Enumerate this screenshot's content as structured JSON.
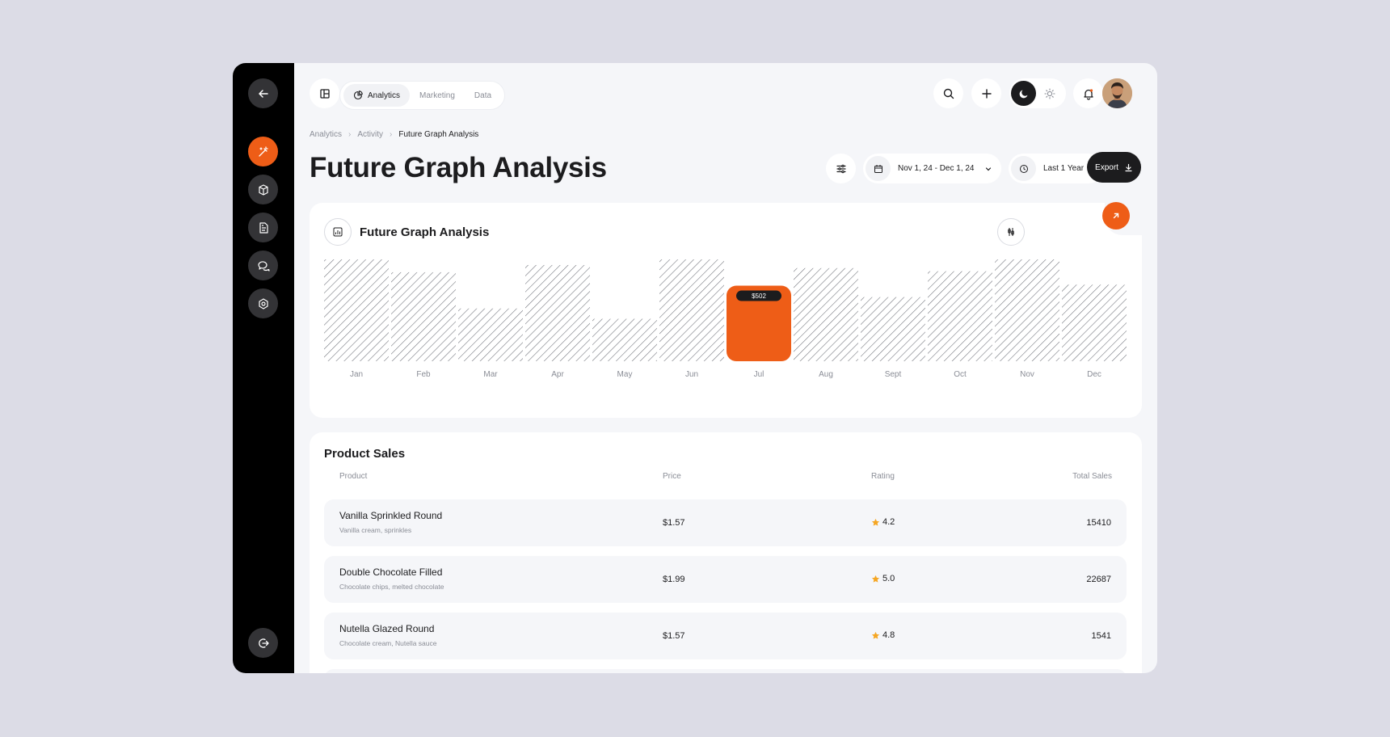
{
  "tabs": [
    {
      "label": "Analytics",
      "active": true
    },
    {
      "label": "Marketing",
      "active": false
    },
    {
      "label": "Data",
      "active": false
    }
  ],
  "breadcrumb": [
    "Analytics",
    "Activity",
    "Future Graph Analysis"
  ],
  "page_title": "Future Graph Analysis",
  "filters": {
    "date_range": "Nov 1, 24 - Dec 1, 24",
    "period": "Last 1 Year",
    "export_label": "Export"
  },
  "colors": {
    "accent": "#ee5d17",
    "dark": "#1c1c1e",
    "background": "#f5f6f9",
    "star": "#f5a623"
  },
  "icons": {
    "sidebar": [
      "back-arrow-icon",
      "magic-wand-icon",
      "box-icon",
      "document-icon",
      "chat-icon",
      "settings-hex-icon",
      "logout-icon"
    ],
    "top": [
      "layout-icon",
      "search-icon",
      "plus-icon",
      "moon-icon",
      "sun-icon",
      "bell-icon"
    ]
  },
  "chart_card": {
    "title": "Future Graph Analysis"
  },
  "chart_data": {
    "type": "bar",
    "categories": [
      "Jan",
      "Feb",
      "Mar",
      "Apr",
      "May",
      "Jun",
      "Jul",
      "Aug",
      "Sept",
      "Oct",
      "Nov",
      "Dec"
    ],
    "values": [
      1.0,
      0.86,
      0.51,
      0.93,
      0.41,
      1.0,
      0.73,
      0.9,
      0.62,
      0.87,
      1.0,
      0.74
    ],
    "highlight_index": 6,
    "highlight_label": "$502"
  },
  "product_sales": {
    "title": "Product Sales",
    "columns": [
      "Product",
      "Price",
      "Rating",
      "Total Sales"
    ],
    "rows": [
      {
        "name": "Vanilla Sprinkled Round",
        "desc": "Vanilla cream, sprinkles",
        "price": "$1.57",
        "rating": "4.2",
        "sales": "15410"
      },
      {
        "name": "Double Chocolate Filled",
        "desc": "Chocolate chips, melted chocolate",
        "price": "$1.99",
        "rating": "5.0",
        "sales": "22687"
      },
      {
        "name": "Nutella Glazed Round",
        "desc": "Chocolate cream, Nutella sauce",
        "price": "$1.57",
        "rating": "4.8",
        "sales": "1541"
      }
    ]
  }
}
